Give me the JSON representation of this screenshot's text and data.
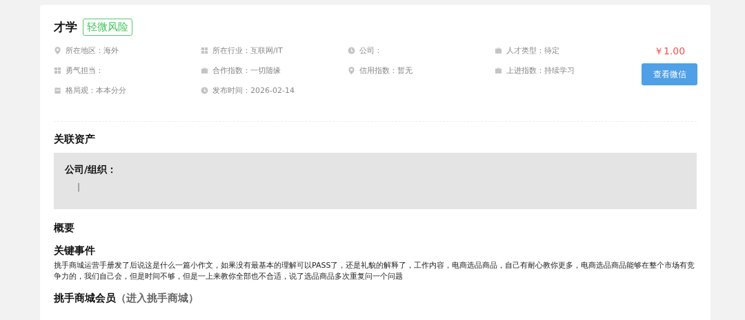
{
  "header": {
    "title": "才学",
    "risk_tag": "轻微风险"
  },
  "fields": [
    {
      "kind": "pin",
      "label": "所在地区：海外"
    },
    {
      "kind": "grid",
      "label": "所在行业：互联网/IT"
    },
    {
      "kind": "clock",
      "label": "公司："
    },
    {
      "kind": "case",
      "label": "人才类型：待定"
    },
    {
      "kind": "grid",
      "label": "勇气担当："
    },
    {
      "kind": "case",
      "label": "合作指数：一切随缘"
    },
    {
      "kind": "pin",
      "label": "信用指数：暂无"
    },
    {
      "kind": "case",
      "label": "上进指数：持续学习"
    },
    {
      "kind": "calendar",
      "label": "格局观：本本分分"
    },
    {
      "kind": "clock",
      "label": "发布时间：2026-02-14"
    }
  ],
  "price": "￥1.00",
  "wechat_button": "查看微信",
  "assets": {
    "heading": "关联资产",
    "label": "公司/组织：",
    "value": "|"
  },
  "summary_heading": "概要",
  "event": {
    "heading": "关键事件",
    "text": "挑手商城运营手册发了后说这是什么一篇小作文，如果没有最基本的理解可以PASS了，还是礼貌的解释了，工作内容，电商选品商品，自己有耐心教你更多，电商选品商品能够在整个市场有竞争力的，我们自己会，但是时间不够，但是一上来教你全部也不合适，说了选品商品多次重复问一个问题"
  },
  "member": {
    "heading": "挑手商城会员",
    "link": "（进入挑手商城）"
  }
}
